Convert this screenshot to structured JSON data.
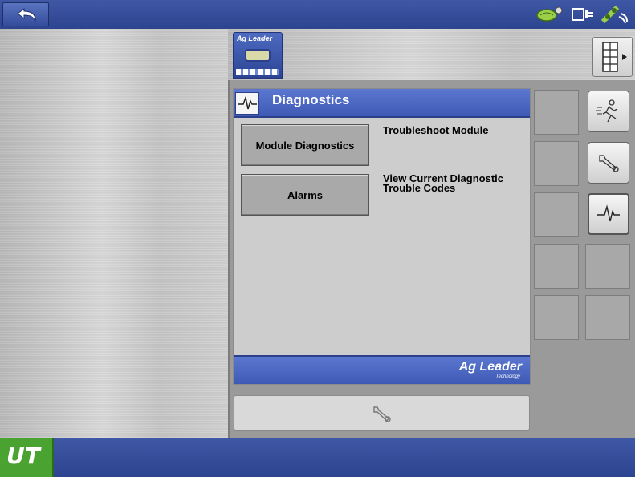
{
  "topbar": {
    "icons": [
      "back-arrow-icon",
      "implement-icon",
      "display-link-icon",
      "gps-satellite-icon"
    ]
  },
  "top_strip": {
    "tile_brand": "Ag Leader",
    "icons": [
      "connector-icon",
      "layout-grid-icon"
    ]
  },
  "panel": {
    "title": "Diagnostics",
    "header_icon": "pulse-icon",
    "options": [
      {
        "button": "Module Diagnostics",
        "description": "Troubleshoot Module"
      },
      {
        "button": "Alarms",
        "description": "View Current Diagnostic Trouble Codes"
      }
    ],
    "footer_brand": "Ag Leader",
    "footer_sub": "Technology"
  },
  "toolbar": {
    "icon": "wrench-icon"
  },
  "side_buttons": [
    "running-man-icon",
    "wrench-icon",
    "pulse-icon"
  ],
  "bottombar": {
    "ut_label": "UT"
  },
  "colors": {
    "accent_blue": "#3f58a5",
    "header_blue": "#4d68c2",
    "ut_green": "#4aa330",
    "panel_gray": "#cdcdcd"
  }
}
